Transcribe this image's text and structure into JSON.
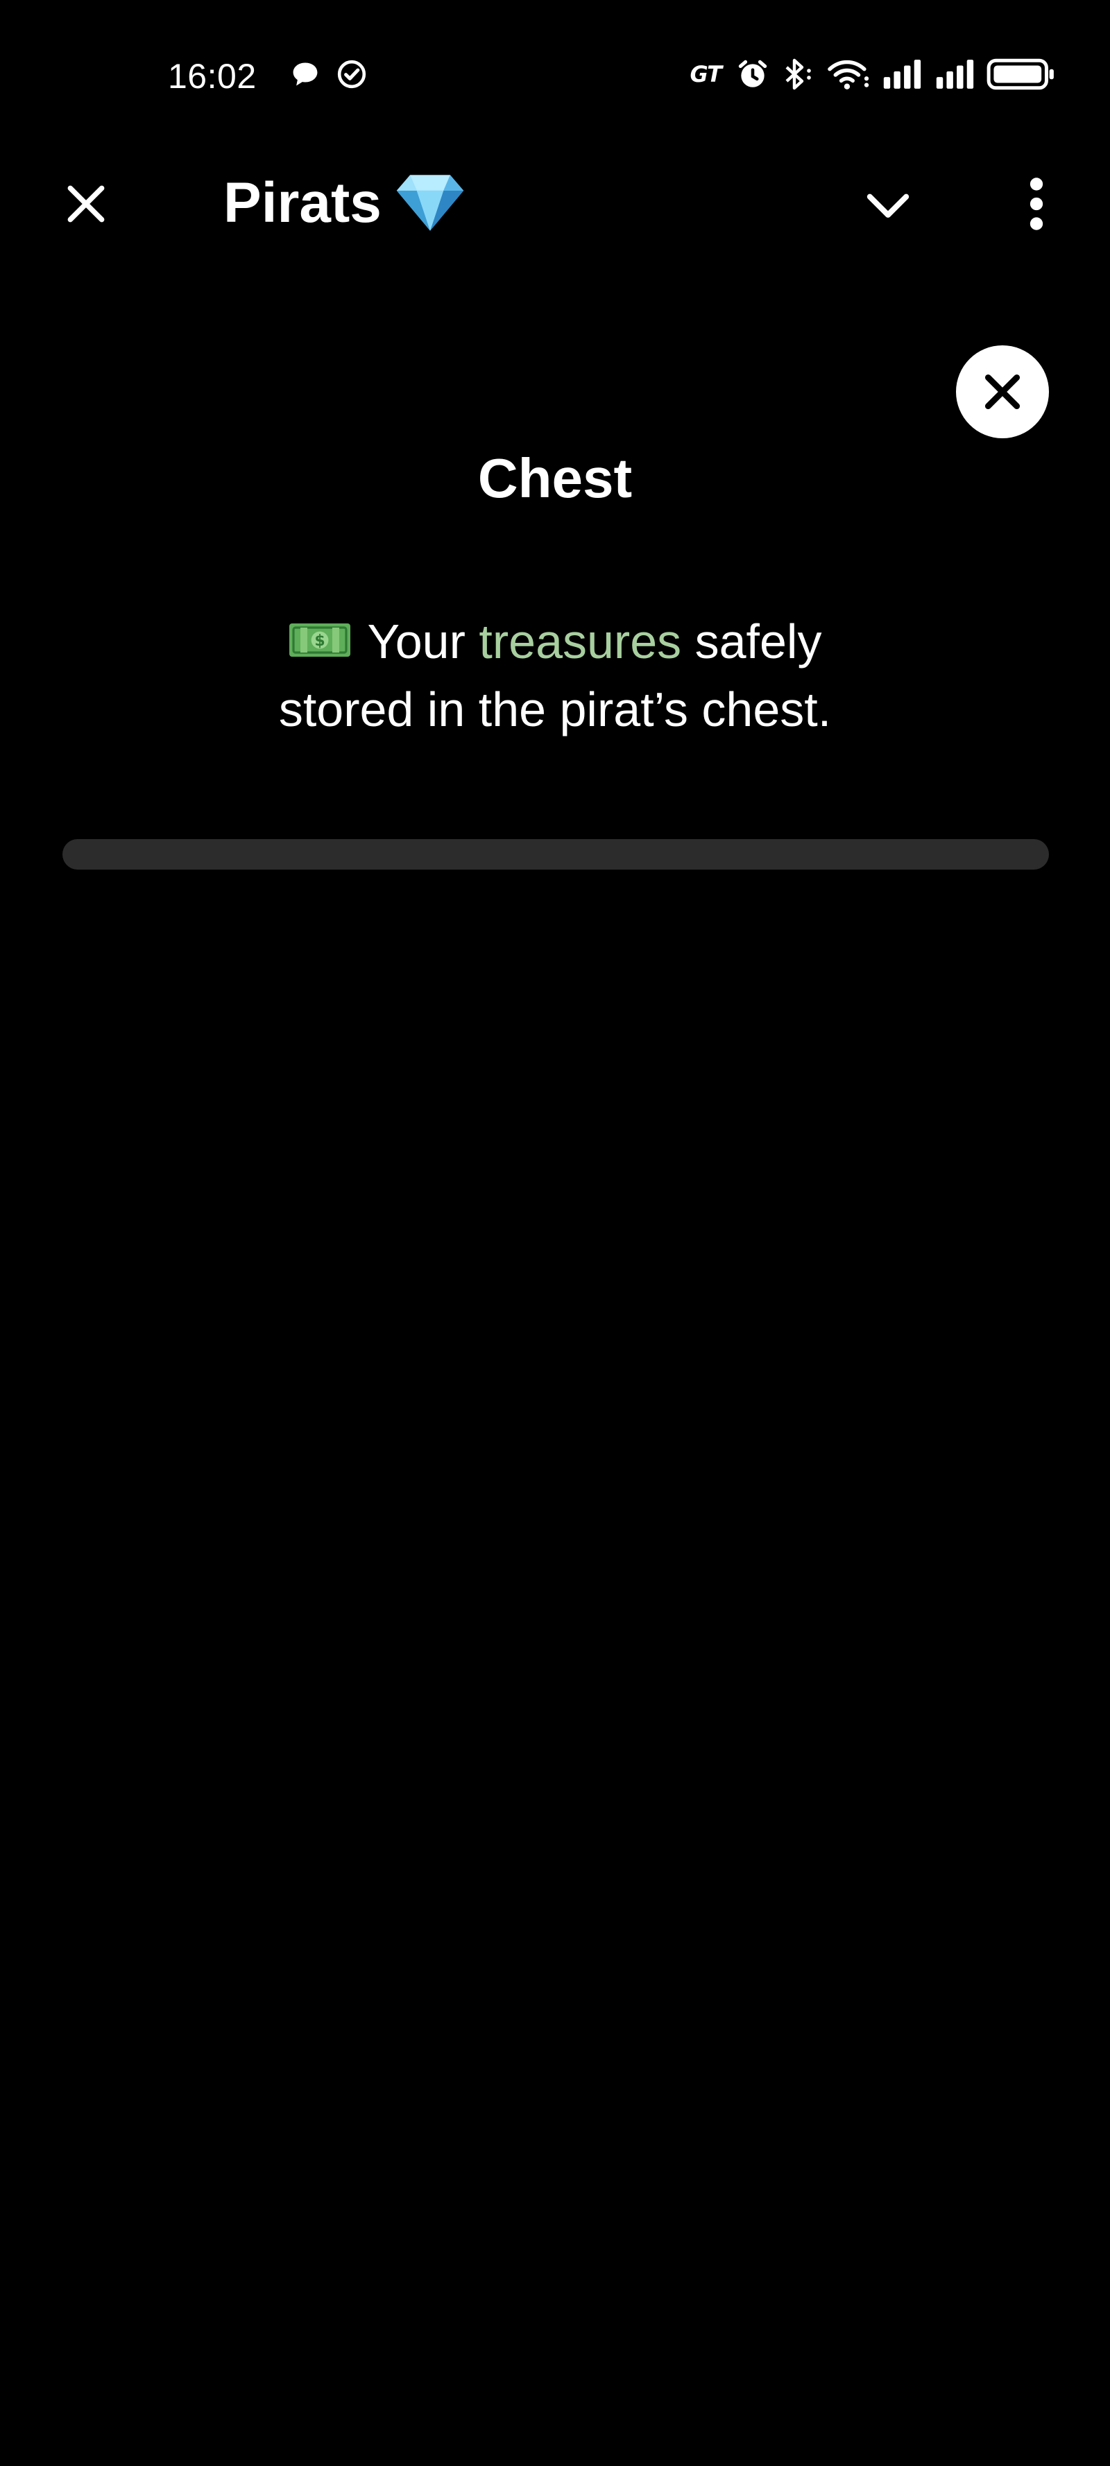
{
  "status_bar": {
    "time": "16:02",
    "carrier_badge": "GT",
    "icons_left": [
      "chat-bubble-icon",
      "check-circle-icon"
    ],
    "icons_right": [
      "gt-badge",
      "alarm-icon",
      "bluetooth-icon",
      "wifi-icon",
      "signal-icon",
      "signal-icon",
      "battery-icon"
    ]
  },
  "app_bar": {
    "title": "Pirats",
    "title_emoji": "gem-icon",
    "left_icon": "close-icon",
    "right_icons": [
      "chevron-down-icon",
      "more-vertical-icon"
    ]
  },
  "sheet": {
    "close_icon": "close-icon",
    "title": "Chest",
    "message": {
      "emoji": "money-icon",
      "part1": "Your",
      "highlight": "treasures",
      "part2": "safely",
      "line2": "stored in the pirat’s chest."
    },
    "progress": 0
  },
  "colors": {
    "background": "#000000",
    "text": "#ffffff",
    "highlight": "#a8cf9f",
    "progress_track": "#2c2c2c",
    "gem": "#6cc6f0",
    "money": "#5fae5a"
  }
}
